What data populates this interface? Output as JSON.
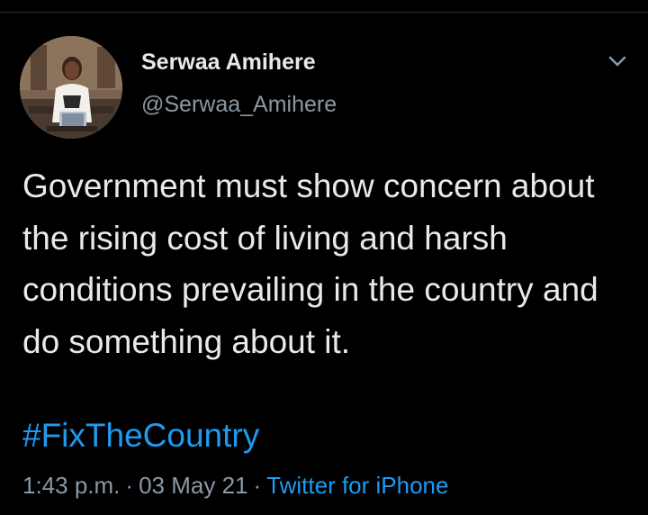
{
  "tweet": {
    "author": {
      "display_name": "Serwaa Amihere",
      "handle": "@Serwaa_Amihere"
    },
    "text": "Government must show concern about the rising cost of living and harsh conditions prevailing in the country and do something about it.",
    "hashtag": "#FixTheCountry",
    "time": "1:43 p.m.",
    "separator": "·",
    "date": "03 May 21",
    "source": "Twitter for iPhone"
  },
  "icons": {
    "options": "chevron-down-icon",
    "avatar": "avatar-photo"
  },
  "colors": {
    "background": "#000000",
    "primary_text": "#e7e9ea",
    "secondary_text": "#8b98a5",
    "link": "#1d9bf0"
  }
}
